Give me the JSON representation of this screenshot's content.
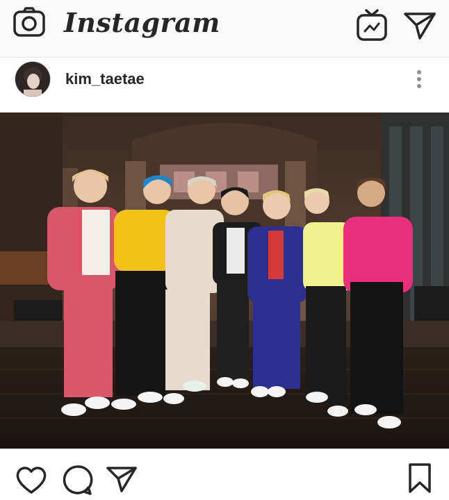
{
  "app": {
    "brand": "Instagram"
  },
  "topbar": {
    "left_icon": "camera-icon",
    "right_icons": [
      "igtv-icon",
      "direct-send-icon"
    ]
  },
  "post": {
    "username": "kim_taetae",
    "avatar_icon": "avatar",
    "menu_icon": "more-vertical-icon",
    "photo_description_icon": "photo-image"
  },
  "actions": {
    "like_icon": "heart-icon",
    "comment_icon": "comment-icon",
    "share_icon": "share-icon",
    "save_icon": "bookmark-icon"
  },
  "colors": {
    "bar_background": "#f9f9f9",
    "text": "#262626"
  }
}
